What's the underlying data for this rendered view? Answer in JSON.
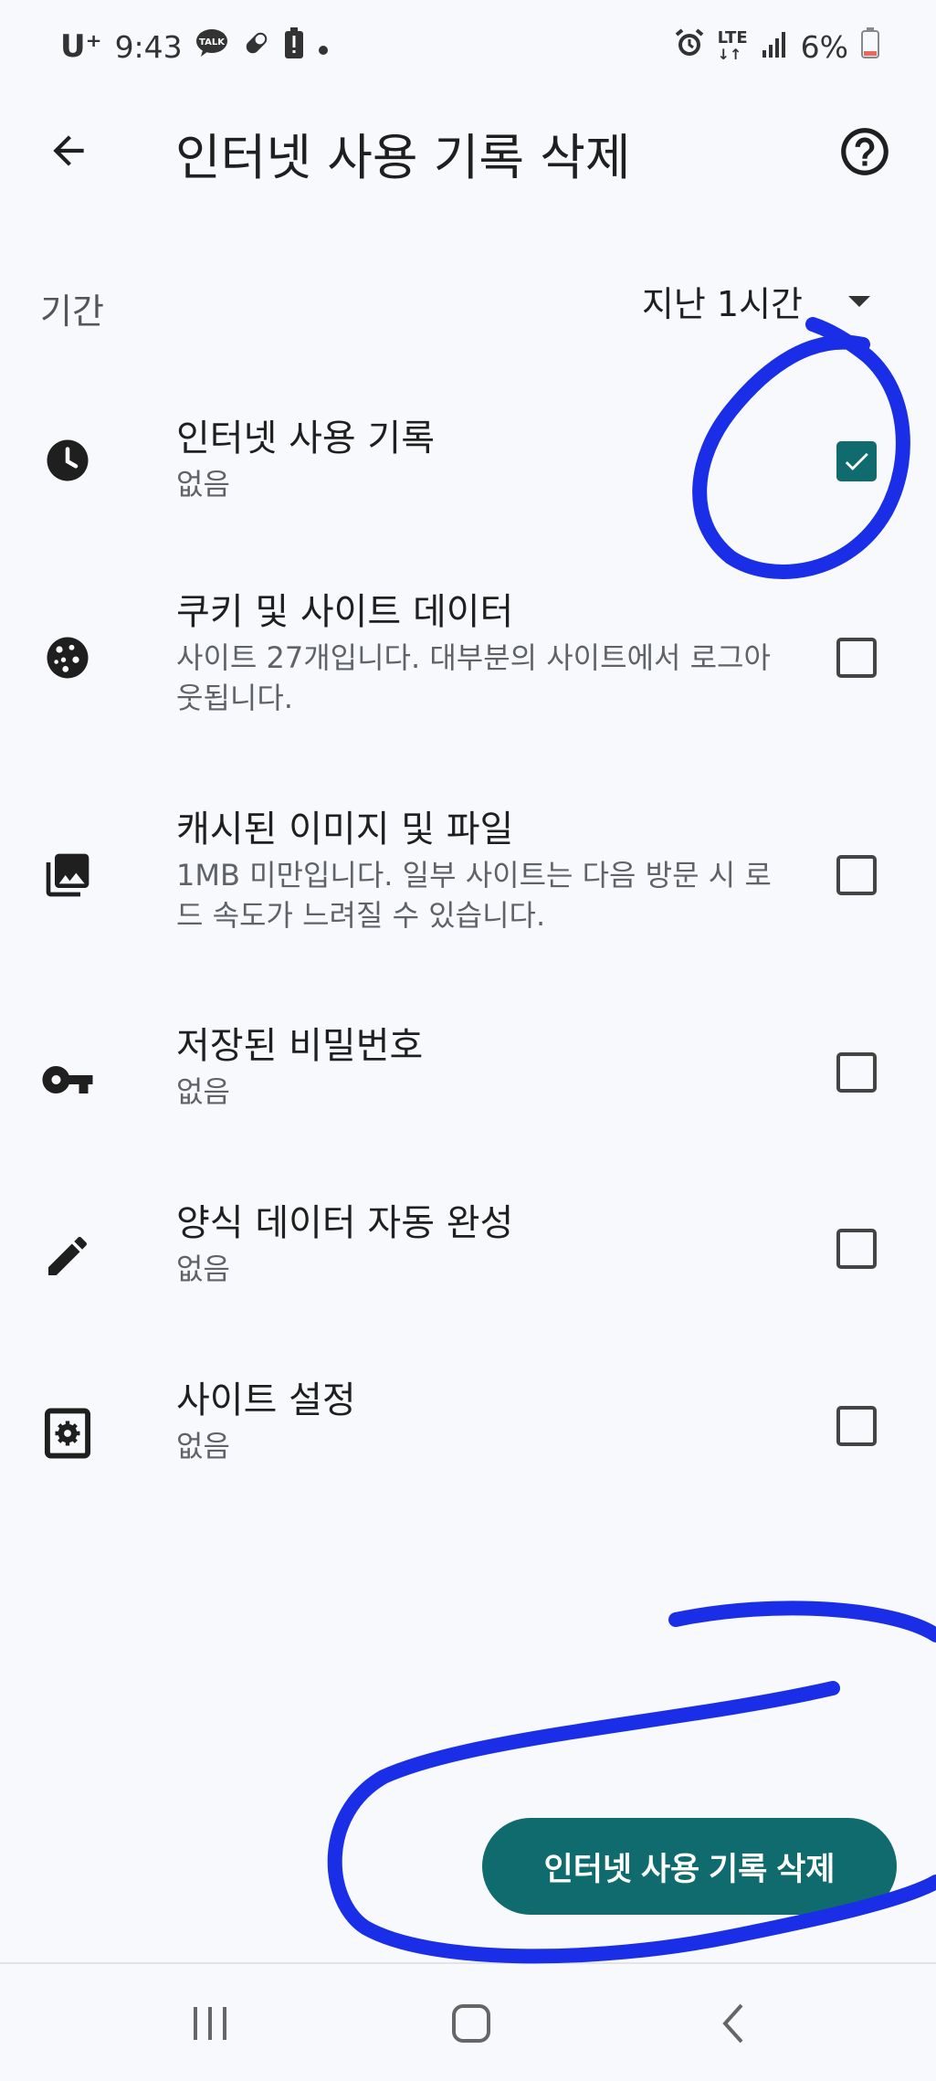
{
  "status_bar": {
    "carrier": "U⁺",
    "time": "9:43",
    "notification_icons": [
      "talk-icon",
      "pill-icon",
      "battery-alert-icon",
      "dot-icon"
    ],
    "talk_label": "TALK",
    "network": "LTE",
    "battery": "6%"
  },
  "app_bar": {
    "title": "인터넷 사용 기록 삭제",
    "back_icon": "arrow-left-icon",
    "help_icon": "help-circle-icon"
  },
  "period": {
    "label": "기간",
    "value": "지난 1시간"
  },
  "items": [
    {
      "title": "인터넷 사용 기록",
      "subtitle": "없음",
      "checked": true,
      "icon": "clock-icon"
    },
    {
      "title": "쿠키 및 사이트 데이터",
      "subtitle": "사이트 27개입니다. 대부분의 사이트에서 로그아웃됩니다.",
      "checked": false,
      "icon": "cookie-icon"
    },
    {
      "title": "캐시된 이미지 및 파일",
      "subtitle": "1MB 미만입니다. 일부 사이트는 다음 방문 시 로드 속도가 느려질 수 있습니다.",
      "checked": false,
      "icon": "image-icon"
    },
    {
      "title": "저장된 비밀번호",
      "subtitle": "없음",
      "checked": false,
      "icon": "key-icon"
    },
    {
      "title": "양식 데이터 자동 완성",
      "subtitle": "없음",
      "checked": false,
      "icon": "pencil-icon"
    },
    {
      "title": "사이트 설정",
      "subtitle": "없음",
      "checked": false,
      "icon": "site-settings-icon"
    }
  ],
  "delete_button": {
    "label": "인터넷 사용 기록 삭제"
  },
  "nav_bar": {
    "icons": [
      "recents-icon",
      "home-icon",
      "back-icon"
    ]
  },
  "colors": {
    "accent": "#0f6b6e",
    "annotation": "#1a2ee8",
    "background": "#f8f9fc"
  }
}
